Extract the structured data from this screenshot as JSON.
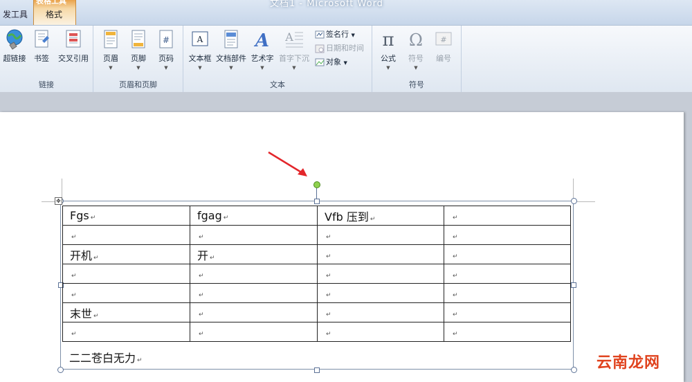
{
  "window": {
    "title": "文档1 - Microsoft Word"
  },
  "tabs": {
    "developer": "发工具",
    "context_group": "表格工具",
    "format": "格式"
  },
  "ribbon": {
    "links_group": {
      "label": "链接",
      "hyperlink": "超链接",
      "bookmark": "书签",
      "cross_reference": "交叉引用"
    },
    "header_footer_group": {
      "label": "页眉和页脚",
      "header": "页眉",
      "footer": "页脚",
      "page_number": "页码"
    },
    "text_group": {
      "label": "文本",
      "text_box": "文本框",
      "quick_parts": "文档部件",
      "wordart": "艺术字",
      "drop_cap": "首字下沉",
      "signature_line": "签名行",
      "date_time": "日期和时间",
      "object": "对象"
    },
    "symbols_group": {
      "label": "符号",
      "equation": "公式",
      "symbol": "符号",
      "number": "编号"
    }
  },
  "document": {
    "table": {
      "rows": [
        [
          "Fgs",
          "fgag",
          "Vfb 压到",
          ""
        ],
        [
          "",
          "",
          "",
          ""
        ],
        [
          "开机",
          "开",
          "",
          ""
        ],
        [
          "",
          "",
          "",
          ""
        ],
        [
          "",
          "",
          "",
          ""
        ],
        [
          "末世",
          "",
          "",
          ""
        ],
        [
          "",
          "",
          "",
          ""
        ]
      ]
    },
    "after_table_text": "二二苍白无力",
    "paragraph_mark": "↵"
  },
  "watermark": "云南龙网"
}
